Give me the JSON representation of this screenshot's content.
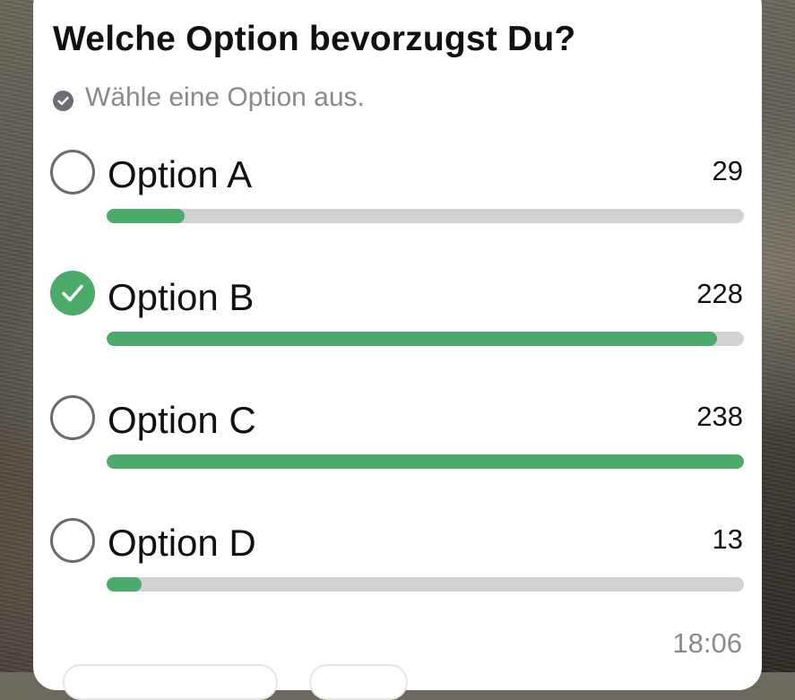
{
  "poll": {
    "question": "Welche Option bevorzugst Du?",
    "hint": "Wähle eine Option aus.",
    "options": [
      {
        "label": "Option A",
        "votes": "29",
        "fraction": 0.122,
        "selected": false
      },
      {
        "label": "Option B",
        "votes": "228",
        "fraction": 0.958,
        "selected": true
      },
      {
        "label": "Option C",
        "votes": "238",
        "fraction": 1.0,
        "selected": false
      },
      {
        "label": "Option D",
        "votes": "13",
        "fraction": 0.055,
        "selected": false
      }
    ],
    "timestamp": "18:06"
  },
  "colors": {
    "accent": "#4caa6a",
    "bar_track": "#d2d2d2",
    "radio_border": "#6b6b6b",
    "secondary_text": "#8a8a8e"
  },
  "icons": {
    "hint": "checkmark-circle-icon",
    "selected": "checkmark-circle-filled-icon",
    "unselected": "radio-circle-icon"
  }
}
